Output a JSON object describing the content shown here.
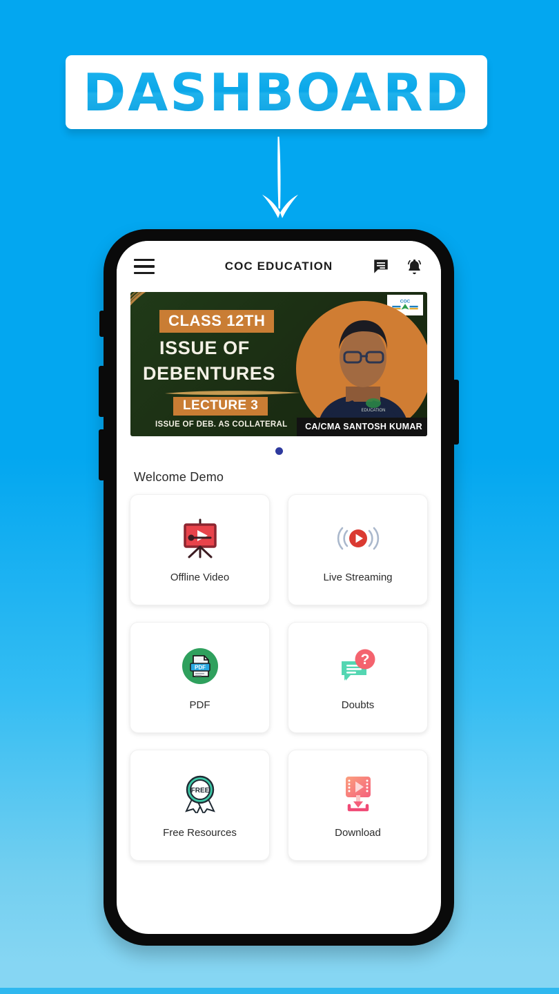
{
  "page": {
    "heading": "DASHBOARD",
    "arrow_icon": "down-arrow-icon",
    "background_top_color": "#03a7f0",
    "background_bottom_color": "#86d6f3",
    "accent_color": "#0aa7e9"
  },
  "app": {
    "header": {
      "menu_icon": "hamburger-menu-icon",
      "title": "COC EDUCATION",
      "chat_icon": "chat-message-icon",
      "bell_icon": "notification-bell-icon"
    },
    "banner": {
      "class_tag": "CLASS 12TH",
      "title_line1": "ISSUE OF",
      "title_line2": "DEBENTURES",
      "lecture_tag": "LECTURE 3",
      "subtitle": "ISSUE OF DEB. AS COLLATERAL",
      "presenter": "CA/CMA SANTOSH KUMAR",
      "watermark": "COC",
      "background_color": "#1d3117",
      "accent_color": "#c97d34",
      "photo_circle_color": "#d07d33"
    },
    "carousel": {
      "dot_count": 1,
      "active_index": 0,
      "dot_color": "#2e3a9e"
    },
    "welcome_text": "Welcome Demo",
    "menu_cards": [
      {
        "label": "Offline Video",
        "icon": "presentation-video-icon",
        "color": "#e8434b"
      },
      {
        "label": "Live Streaming",
        "icon": "live-broadcast-icon",
        "color": "#da3a32"
      },
      {
        "label": "PDF",
        "icon": "pdf-document-icon",
        "color": "#2fa05d"
      },
      {
        "label": "Doubts",
        "icon": "question-chat-icon",
        "color": "#f4636e"
      },
      {
        "label": "Free Resources",
        "icon": "free-badge-icon",
        "color": "#3ec9a7"
      },
      {
        "label": "Download",
        "icon": "download-video-icon",
        "color": "#f97e7e"
      }
    ]
  }
}
